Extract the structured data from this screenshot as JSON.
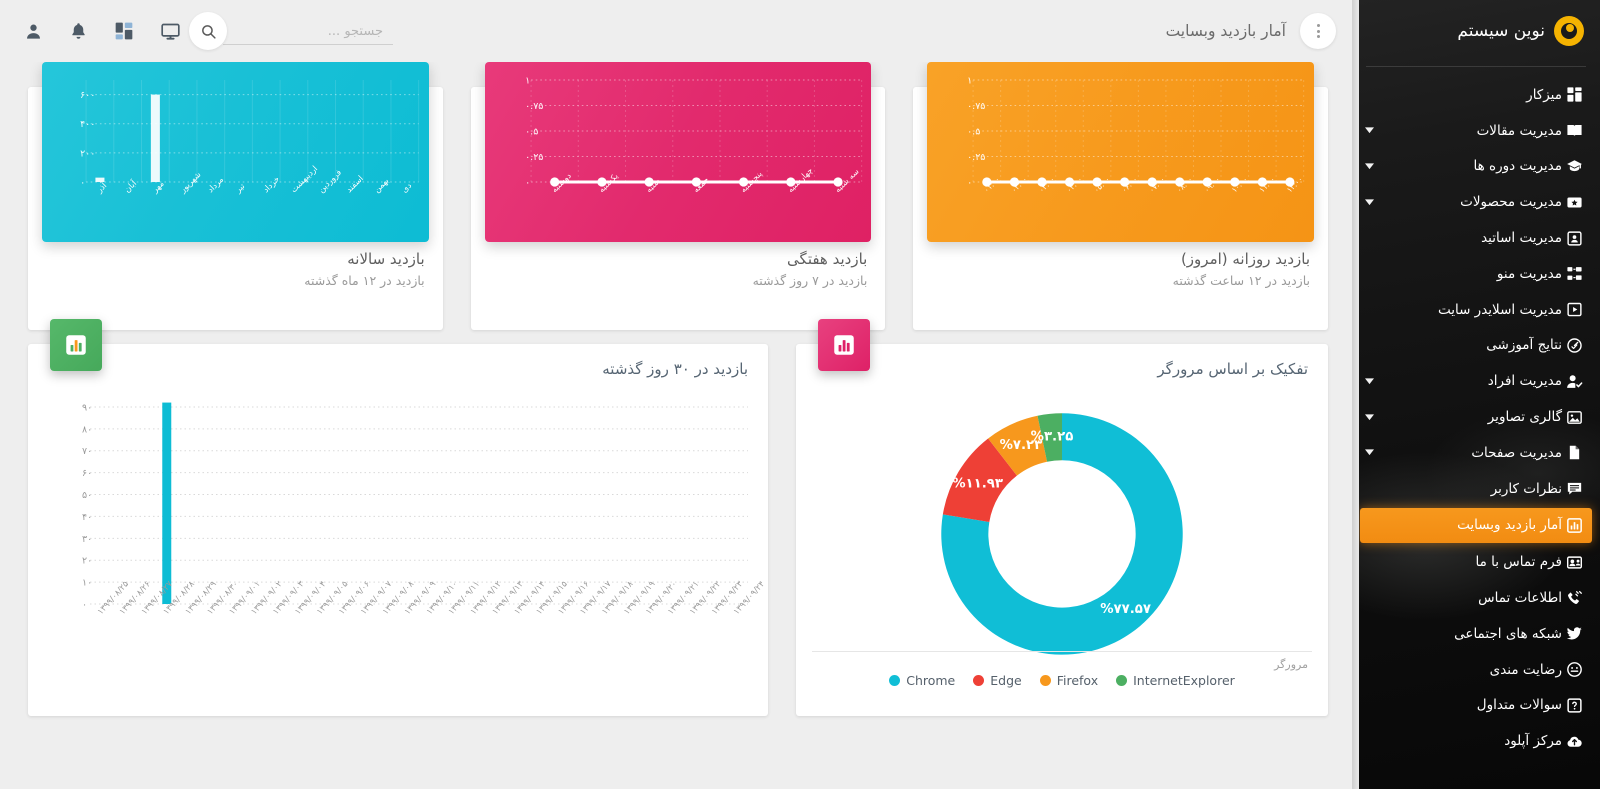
{
  "sidebar": {
    "brand": "نوین سیستم",
    "items": [
      {
        "label": "میزکار",
        "icon": "dashboard-grid-icon",
        "caret": false,
        "active": false
      },
      {
        "label": "مدیریت مقالات",
        "icon": "book-icon",
        "caret": true,
        "active": false
      },
      {
        "label": "مدیریت دوره ها",
        "icon": "graduation-cap-icon",
        "caret": true,
        "active": false
      },
      {
        "label": "مدیریت محصولات",
        "icon": "ticket-star-icon",
        "caret": true,
        "active": false
      },
      {
        "label": "مدیریت اساتید",
        "icon": "id-card-icon",
        "caret": false,
        "active": false
      },
      {
        "label": "مدیریت منو",
        "icon": "sitemap-icon",
        "caret": false,
        "active": false
      },
      {
        "label": "مدیریت اسلایدر سایت",
        "icon": "play-box-icon",
        "caret": false,
        "active": false
      },
      {
        "label": "نتایج آموزشی",
        "icon": "gauge-check-icon",
        "caret": false,
        "active": false
      },
      {
        "label": "مدیریت افراد",
        "icon": "user-check-icon",
        "caret": true,
        "active": false
      },
      {
        "label": "گالری تصاویر",
        "icon": "image-icon",
        "caret": true,
        "active": false
      },
      {
        "label": "مدیریت صفحات",
        "icon": "file-icon",
        "caret": true,
        "active": false
      },
      {
        "label": "نظرات کاربر",
        "icon": "comment-lines-icon",
        "caret": false,
        "active": false
      },
      {
        "label": "آمار بازدید وبسایت",
        "icon": "bar-chart-icon",
        "caret": false,
        "active": true
      },
      {
        "label": "فرم تماس با ما",
        "icon": "contact-card-icon",
        "caret": false,
        "active": false
      },
      {
        "label": "اطلاعات تماس",
        "icon": "phone-icon",
        "caret": false,
        "active": false
      },
      {
        "label": "شبکه های اجتماعی",
        "icon": "twitter-bird-icon",
        "caret": false,
        "active": false
      },
      {
        "label": "رضایت مندی",
        "icon": "smiley-face-icon",
        "caret": false,
        "active": false
      },
      {
        "label": "سوالات متداول",
        "icon": "question-box-icon",
        "caret": false,
        "active": false
      },
      {
        "label": "مرکز آپلود",
        "icon": "cloud-upload-icon",
        "caret": false,
        "active": false
      }
    ],
    "accent_color": "#f7981d"
  },
  "header": {
    "page_title": "آمار بازدید وبسایت",
    "kebab_icon": "kebab-menu-icon",
    "search_placeholder": "جستجو ...",
    "search_value": "",
    "search_icon": "search-icon",
    "icons": [
      {
        "name": "monitor-icon"
      },
      {
        "name": "apps-grid-icon"
      },
      {
        "name": "bell-icon"
      },
      {
        "name": "user-icon"
      }
    ]
  },
  "cards": {
    "yearly": {
      "title": "بازدید سالانه",
      "subtitle": "بازدید در ۱۲ ماه گذشته",
      "color": "#0dbcd4"
    },
    "weekly": {
      "title": "بازدید هفتگی",
      "subtitle": "بازدید در ۷ روز گذشته",
      "color": "#e22a6d"
    },
    "daily": {
      "title": "بازدید روزانه (امروز)",
      "subtitle": "بازدید در ۱۲ ساعت گذشته",
      "color": "#f79a1d"
    }
  },
  "panels": {
    "thirty_day": {
      "title": "بازدید در ۳۰ روز گذشته",
      "badge_icon": "bar-chart-icon",
      "badge_color": "#4caf62"
    },
    "browser": {
      "title": "تفکیک بر اساس مرورگر",
      "badge_icon": "bar-chart-icon",
      "badge_color": "#de2167",
      "legend_caption": "مرورگر"
    }
  },
  "chart_data": [
    {
      "type": "bar",
      "id": "yearly-visits",
      "title": "بازدید سالانه",
      "categories": [
        "آذر",
        "آبان",
        "مهر",
        "شهریور",
        "مرداد",
        "تیر",
        "خرداد",
        "اردیبهشت",
        "فروردین",
        "اسفند",
        "بهمن",
        "دی"
      ],
      "values": [
        30,
        0,
        600,
        0,
        0,
        0,
        0,
        0,
        0,
        0,
        0,
        0
      ],
      "ytick_labels": [
        "۰",
        "۲۰۰",
        "۴۰۰",
        "۶۰۰"
      ],
      "ytick_values": [
        0,
        200,
        400,
        600
      ],
      "ylim": [
        0,
        700
      ],
      "grid": true,
      "series_color": "#ffffff",
      "background": "#0dbcd4"
    },
    {
      "type": "line",
      "id": "weekly-visits",
      "title": "بازدید هفتگی",
      "categories": [
        "دوشنبه",
        "یکشنبه",
        "شنبه",
        "جمعه",
        "پنجشنبه",
        "چهارشنبه",
        "سه شنبه"
      ],
      "values": [
        0,
        0,
        0,
        0,
        0,
        0,
        0
      ],
      "ytick_labels": [
        "۰",
        "۰.۲۵",
        "۰.۵",
        "۰.۷۵",
        "۱"
      ],
      "ytick_values": [
        0,
        0.25,
        0.5,
        0.75,
        1
      ],
      "ylim": [
        0,
        1
      ],
      "grid": true,
      "series_color": "#ffffff",
      "background": "#e22a6d"
    },
    {
      "type": "line",
      "id": "daily-visits",
      "title": "بازدید روزانه (امروز)",
      "categories": [
        "۰۱:۰۰",
        "۰۲:۰۰",
        "۰۳:۰۰",
        "۰۴:۰۰",
        "۰۵:۰۰",
        "۰۶:۰۰",
        "۰۷:۰۰",
        "۰۸:۰۰",
        "۰۹:۰۰",
        "۱۰:۰۰",
        "۱۱:۰۰",
        "۱۲:۰۰"
      ],
      "values": [
        0,
        0,
        0,
        0,
        0,
        0,
        0,
        0,
        0,
        0,
        0,
        0
      ],
      "ytick_labels": [
        "۰",
        "۰.۲۵",
        "۰.۵",
        "۰.۷۵",
        "۱"
      ],
      "ytick_values": [
        0,
        0.25,
        0.5,
        0.75,
        1
      ],
      "ylim": [
        0,
        1
      ],
      "grid": true,
      "series_color": "#ffffff",
      "background": "#f79a1d"
    },
    {
      "type": "bar",
      "id": "thirty-day-visits",
      "title": "بازدید در ۳۰ روز گذشته",
      "categories": [
        "۱۳۹۹/۰۸/۲۵",
        "۱۳۹۹/۰۸/۲۶",
        "۱۳۹۹/۰۸/۲۷",
        "۱۳۹۹/۰۸/۲۸",
        "۱۳۹۹/۰۸/۲۹",
        "۱۳۹۹/۰۸/۳۰",
        "۱۳۹۹/۰۹/۰۱",
        "۱۳۹۹/۰۹/۰۲",
        "۱۳۹۹/۰۹/۰۳",
        "۱۳۹۹/۰۹/۰۴",
        "۱۳۹۹/۰۹/۰۵",
        "۱۳۹۹/۰۹/۰۶",
        "۱۳۹۹/۰۹/۰۷",
        "۱۳۹۹/۰۹/۰۸",
        "۱۳۹۹/۰۹/۰۹",
        "۱۳۹۹/۰۹/۱۰",
        "۱۳۹۹/۰۹/۱۱",
        "۱۳۹۹/۰۹/۱۲",
        "۱۳۹۹/۰۹/۱۳",
        "۱۳۹۹/۰۹/۱۴",
        "۱۳۹۹/۰۹/۱۵",
        "۱۳۹۹/۰۹/۱۶",
        "۱۳۹۹/۰۹/۱۷",
        "۱۳۹۹/۰۹/۱۸",
        "۱۳۹۹/۰۹/۱۹",
        "۱۳۹۹/۰۹/۲۰",
        "۱۳۹۹/۰۹/۲۱",
        "۱۳۹۹/۰۹/۲۲",
        "۱۳۹۹/۰۹/۲۳",
        "۱۳۹۹/۰۹/۲۴"
      ],
      "values": [
        0,
        0,
        0,
        92,
        0,
        0,
        0,
        0,
        0,
        0,
        0,
        0,
        0,
        0,
        0,
        0,
        0,
        0,
        0,
        0,
        0,
        0,
        0,
        0,
        0,
        0,
        0,
        0,
        0,
        0
      ],
      "ytick_labels": [
        "۰",
        "۱۰",
        "۲۰",
        "۳۰",
        "۴۰",
        "۵۰",
        "۶۰",
        "۷۰",
        "۸۰",
        "۹۰"
      ],
      "ytick_values": [
        0,
        10,
        20,
        30,
        40,
        50,
        60,
        70,
        80,
        90
      ],
      "ylim": [
        0,
        95
      ],
      "grid": true,
      "series_color": "#0dbcd4",
      "background": "#ffffff"
    },
    {
      "type": "pie",
      "id": "browser-breakdown",
      "title": "تفکیک بر اساس مرورگر",
      "donut": true,
      "legend_position": "bottom",
      "legend_title": "مرورگر",
      "labels": [
        "Chrome",
        "Edge",
        "Firefox",
        "InternetExplorer"
      ],
      "values": [
        77.57,
        11.93,
        7.23,
        3.25
      ],
      "value_labels": [
        "%۷۷.۵۷",
        "%۱۱.۹۳",
        "%۷.۲۳",
        "%۳.۲۵"
      ],
      "colors": [
        "#10bed6",
        "#ee4036",
        "#f7981d",
        "#4caf62"
      ]
    }
  ]
}
